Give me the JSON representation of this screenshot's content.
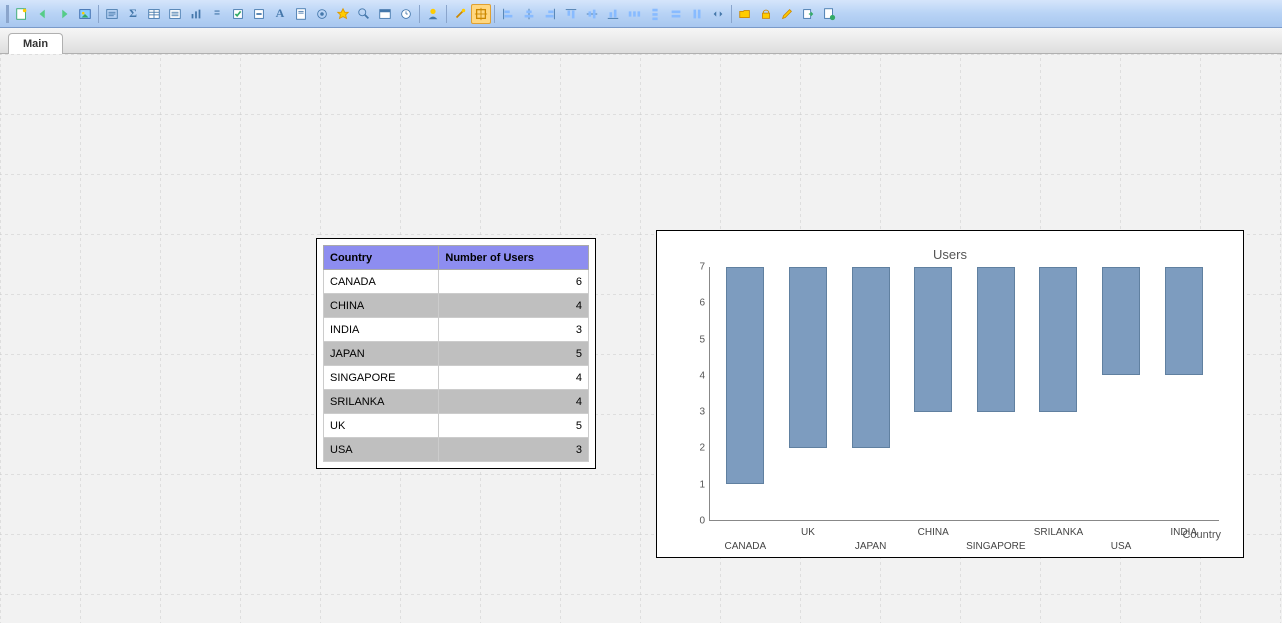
{
  "toolbar": {
    "icons": [
      "new",
      "back",
      "forward",
      "image",
      "text",
      "sigma",
      "table",
      "list",
      "chart",
      "equal",
      "checkbox",
      "minus",
      "font",
      "page",
      "target",
      "star",
      "zoom",
      "window",
      "clock",
      "separator",
      "user",
      "separator",
      "wand",
      "select",
      "separator",
      "align-left",
      "align-center",
      "align-right",
      "align-top",
      "align-middle",
      "align-bottom",
      "dist-h",
      "dist-v",
      "grid",
      "snap",
      "separator",
      "open",
      "lock",
      "edit",
      "export",
      "refresh"
    ]
  },
  "tabs": {
    "main": "Main"
  },
  "table": {
    "headers": {
      "country": "Country",
      "users": "Number of Users"
    },
    "rows": [
      {
        "country": "CANADA",
        "users": "6"
      },
      {
        "country": "CHINA",
        "users": "4"
      },
      {
        "country": "INDIA",
        "users": "3"
      },
      {
        "country": "JAPAN",
        "users": "5"
      },
      {
        "country": "SINGAPORE",
        "users": "4"
      },
      {
        "country": "SRILANKA",
        "users": "4"
      },
      {
        "country": "UK",
        "users": "5"
      },
      {
        "country": "USA",
        "users": "3"
      }
    ]
  },
  "chart": {
    "title": "Users",
    "xlabel": "Country",
    "yticks": [
      "0",
      "1",
      "2",
      "3",
      "4",
      "5",
      "6",
      "7"
    ]
  },
  "chart_data": {
    "type": "bar",
    "title": "Users",
    "xlabel": "Country",
    "ylabel": "",
    "ylim": [
      0,
      7
    ],
    "categories": [
      "CANADA",
      "UK",
      "JAPAN",
      "CHINA",
      "SINGAPORE",
      "SRILANKA",
      "USA",
      "INDIA"
    ],
    "values": [
      6,
      5,
      5,
      4,
      4,
      4,
      3,
      3
    ]
  }
}
